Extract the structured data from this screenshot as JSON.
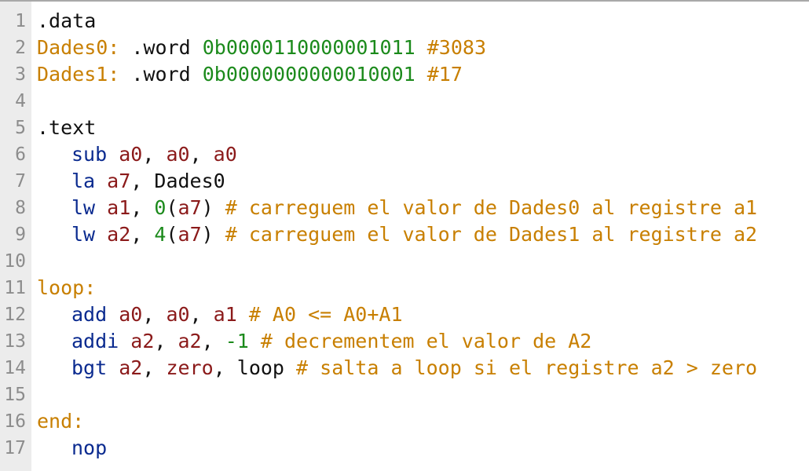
{
  "editor": {
    "lines": [
      {
        "n": "1"
      },
      {
        "n": "2"
      },
      {
        "n": "3"
      },
      {
        "n": "4"
      },
      {
        "n": "5"
      },
      {
        "n": "6"
      },
      {
        "n": "7"
      },
      {
        "n": "8"
      },
      {
        "n": "9"
      },
      {
        "n": "10"
      },
      {
        "n": "11"
      },
      {
        "n": "12"
      },
      {
        "n": "13"
      },
      {
        "n": "14"
      },
      {
        "n": "15"
      },
      {
        "n": "16"
      },
      {
        "n": "17"
      }
    ],
    "code": {
      "l1": {
        "dir": ".data"
      },
      "l2": {
        "label": "Dades0:",
        "dir": ".word",
        "value": "0b0000110000001011",
        "comment": "#3083"
      },
      "l3": {
        "label": "Dades1:",
        "dir": ".word",
        "value": "0b0000000000010001",
        "comment": "#17"
      },
      "l5": {
        "dir": ".text"
      },
      "l6": {
        "op": "sub",
        "r1": "a0",
        "r2": "a0",
        "r3": "a0"
      },
      "l7": {
        "op": "la",
        "r1": "a7",
        "sym": "Dades0"
      },
      "l8": {
        "op": "lw",
        "r1": "a1",
        "off": "0",
        "base": "a7",
        "comment": "# carreguem el valor de Dades0 al registre a1"
      },
      "l9": {
        "op": "lw",
        "r1": "a2",
        "off": "4",
        "base": "a7",
        "comment": "# carreguem el valor de Dades1 al registre a2"
      },
      "l11": {
        "label": "loop:"
      },
      "l12": {
        "op": "add",
        "r1": "a0",
        "r2": "a0",
        "r3": "a1",
        "comment": "# A0 <= A0+A1"
      },
      "l13": {
        "op": "addi",
        "r1": "a2",
        "r2": "a2",
        "imm": "-1",
        "comment": "# decrementem el valor de A2"
      },
      "l14": {
        "op": "bgt",
        "r1": "a2",
        "r2": "zero",
        "sym": "loop",
        "comment": "# salta a loop si el registre a2 > zero"
      },
      "l16": {
        "label": "end:"
      },
      "l17": {
        "op": "nop"
      }
    },
    "colors": {
      "background": "#ffffff",
      "gutter": "#ececec",
      "line_number": "#8c8c8c",
      "keyword": "#0a2a8f",
      "register": "#8b1a1a",
      "number": "#1b8a1b",
      "comment": "#c87f00",
      "label": "#c87f00",
      "text": "#111111"
    }
  }
}
